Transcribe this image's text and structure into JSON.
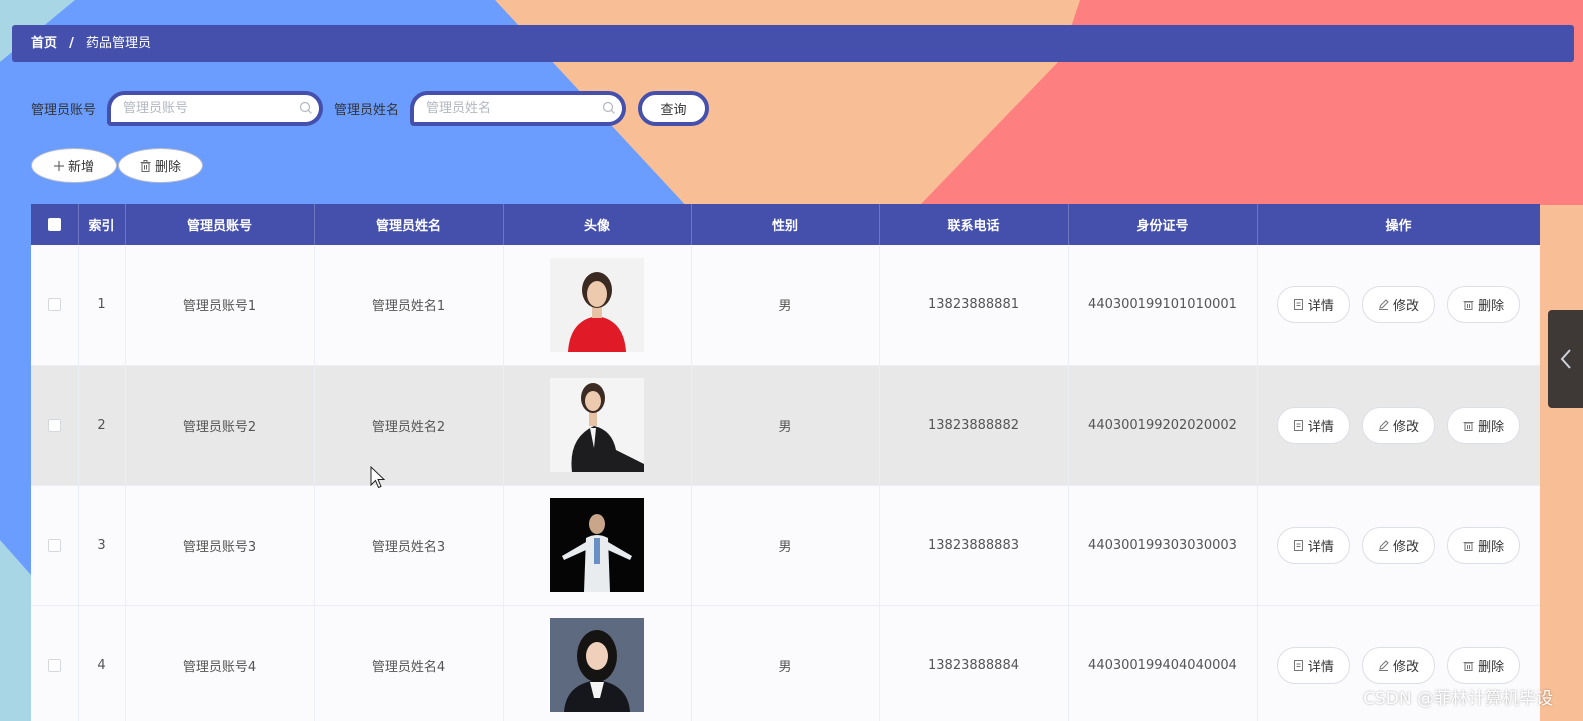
{
  "colors": {
    "primary": "#4450ab",
    "bg_blue": "#6a9dff",
    "bg_peach": "#f8bf96",
    "bg_coral": "#fe7f7f",
    "bg_light_blue": "#a9d6e5"
  },
  "breadcrumb": {
    "home": "首页",
    "separator": "/",
    "current": "药品管理员"
  },
  "search": {
    "account_label": "管理员账号",
    "account_placeholder": "管理员账号",
    "name_label": "管理员姓名",
    "name_placeholder": "管理员姓名",
    "query_label": "查询"
  },
  "actions": {
    "add_label": "新增",
    "delete_label": "删除"
  },
  "table": {
    "headers": [
      "索引",
      "管理员账号",
      "管理员姓名",
      "头像",
      "性别",
      "联系电话",
      "身份证号",
      "操作"
    ],
    "rows": [
      {
        "index": "1",
        "account": "管理员账号1",
        "name": "管理员姓名1",
        "avatar": "avatar-woman-red",
        "gender": "男",
        "phone": "13823888881",
        "id_card": "440300199101010001"
      },
      {
        "index": "2",
        "account": "管理员账号2",
        "name": "管理员姓名2",
        "avatar": "avatar-woman-black-suit",
        "gender": "男",
        "phone": "13823888882",
        "id_card": "440300199202020002"
      },
      {
        "index": "3",
        "account": "管理员账号3",
        "name": "管理员姓名3",
        "avatar": "avatar-man-white-coat",
        "gender": "男",
        "phone": "13823888883",
        "id_card": "440300199303030003"
      },
      {
        "index": "4",
        "account": "管理员账号4",
        "name": "管理员姓名4",
        "avatar": "avatar-woman-dark-hair",
        "gender": "男",
        "phone": "13823888884",
        "id_card": "440300199404040004"
      }
    ],
    "row_actions": {
      "detail": "详情",
      "edit": "修改",
      "delete": "删除"
    }
  },
  "watermark": "CSDN @菲林计算机毕设"
}
